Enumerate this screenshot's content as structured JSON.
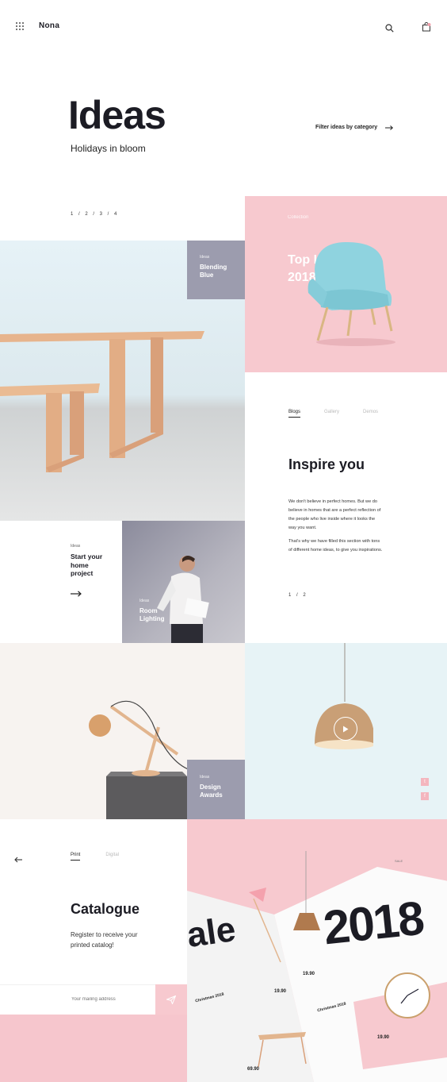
{
  "header": {
    "brand": "Nona",
    "menu_icon": "grid-icon",
    "search_icon": "search-icon",
    "cart_icon": "bag-icon"
  },
  "hero": {
    "title": "Ideas",
    "subtitle": "Holidays in bloom",
    "filter_label": "Filter ideas by category",
    "pager": "1 / 2 / 3 / 4"
  },
  "top_ideas": {
    "kicker": "Collection",
    "title_line1": "Top Ideas",
    "title_line2": "2018"
  },
  "blending": {
    "kicker": "Ideas",
    "title_line1": "Blending",
    "title_line2": "Blue"
  },
  "blog": {
    "tabs": [
      "Blogs",
      "Gallery",
      "Demos"
    ],
    "title": "Inspire you",
    "para1": "We don't believe in perfect homes. But we do believe in homes that are a perfect reflection of the people who live inside where it looks the way you want.",
    "para2": "That's why we have filled this section with tons of different home ideas, to give you inspirations.",
    "pager": "1 / 2"
  },
  "start": {
    "kicker": "Ideas",
    "title_line1": "Start your",
    "title_line2": "home",
    "title_line3": "project"
  },
  "room": {
    "kicker": "Ideas",
    "title_line1": "Room",
    "title_line2": "Lighting"
  },
  "design": {
    "kicker": "Ideas",
    "title_line1": "Design",
    "title_line2": "Awards"
  },
  "social": {
    "twitter": "t",
    "facebook": "f"
  },
  "catalogue": {
    "tabs": [
      "Print",
      "Digital"
    ],
    "title": "Catalogue",
    "text": "Register to receive your printed catalog!",
    "email_placeholder": "Your mailing address"
  },
  "magazine": {
    "headline_left": "ale",
    "headline_right": "2018",
    "sale_tag": "SALE",
    "christmas1": "Christmas 2018",
    "christmas2": "Christmas 2018",
    "price1": "19.90",
    "price2": "19.90",
    "price3": "69.90",
    "price4": "19.90"
  },
  "colors": {
    "accent_pink": "#f7c9cf",
    "tile_gray": "#9c9cae",
    "ink": "#1c1c24",
    "sky": "#e7f3f6"
  }
}
